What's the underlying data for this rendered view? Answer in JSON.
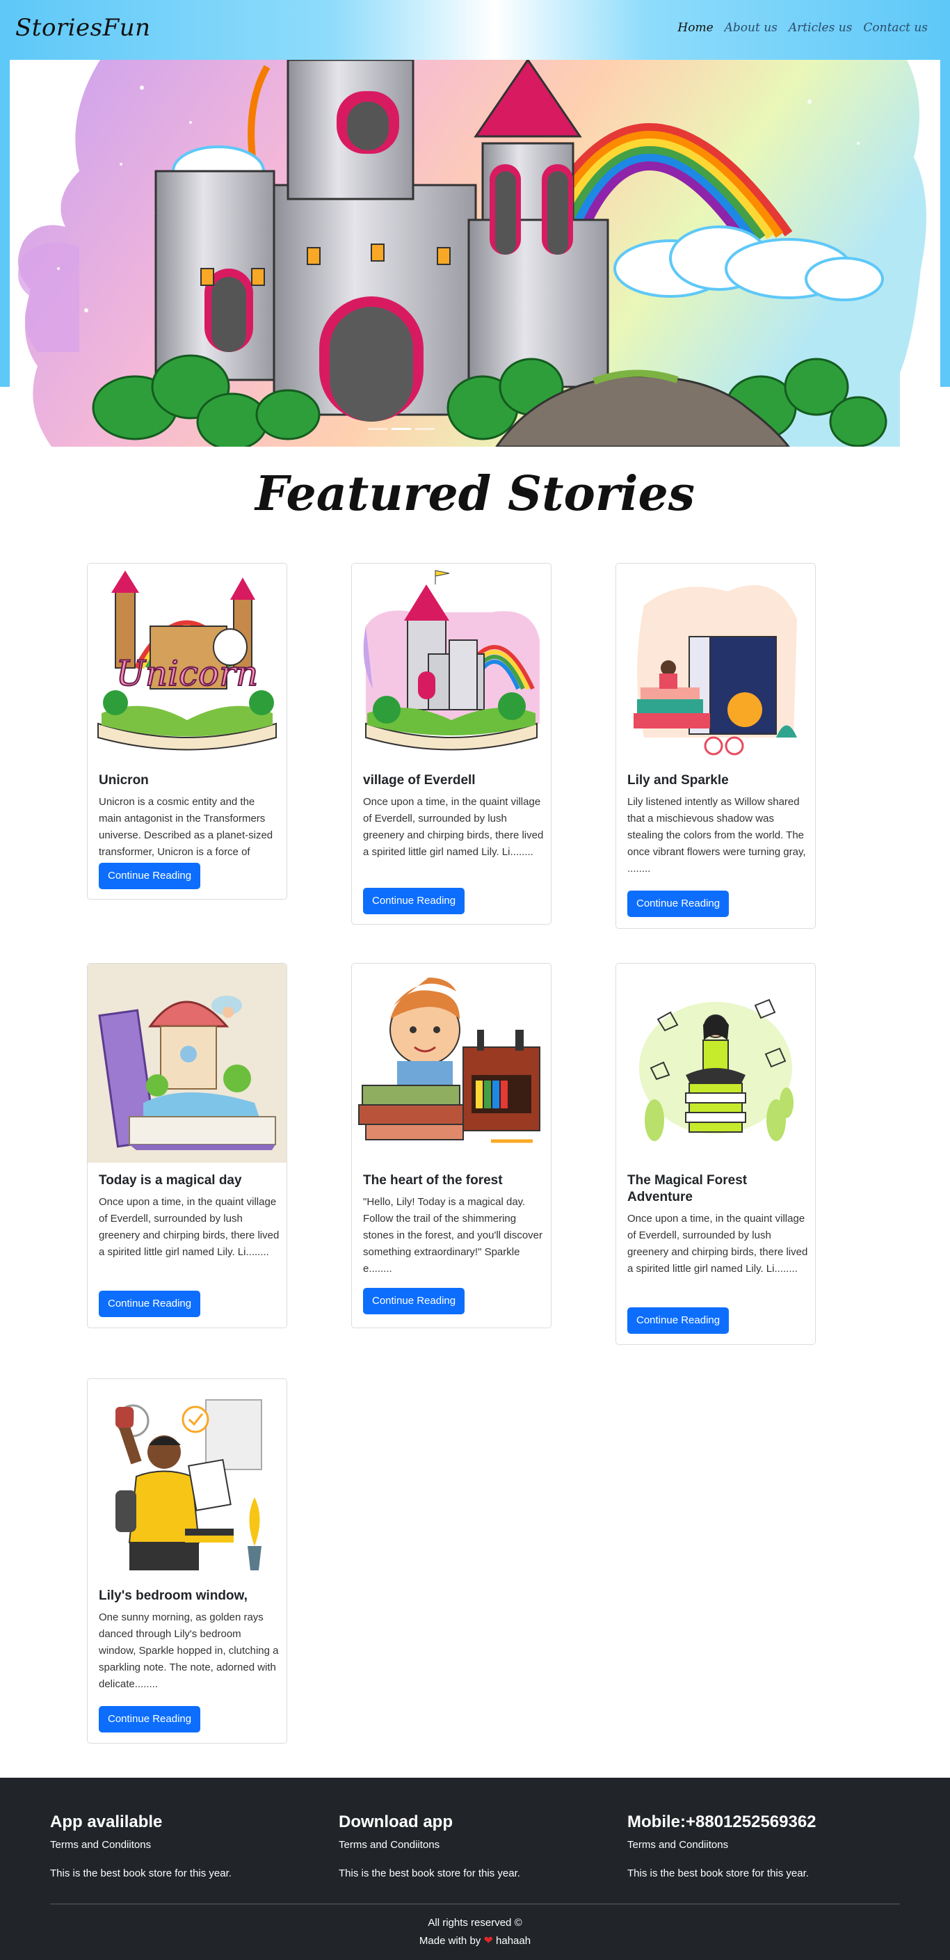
{
  "nav": {
    "brand": "StoriesFun",
    "links": [
      "Home",
      "About us",
      "Articles us",
      "Contact us"
    ]
  },
  "hero": {
    "slide_count": 3,
    "active_slide": 1
  },
  "featured": {
    "title": "Featured Stories",
    "cards": [
      {
        "title": "Unicron",
        "text": "Unicron is a cosmic entity and the main antagonist in the Transformers universe. Described as a planet-sized transformer, Unicron is a force of destru........",
        "button": "Continue Reading",
        "image": "unicorn-castle-book"
      },
      {
        "title": "village of Everdell",
        "text": "Once upon a time, in the quaint village of Everdell, surrounded by lush greenery and chirping birds, there lived a spirited little girl named Lily. Li........",
        "button": "Continue Reading",
        "image": "castle-rainbow-book"
      },
      {
        "title": "Lily and Sparkle",
        "text": "Lily listened intently as Willow shared that a mischievous shadow was stealing the colors from the world. The once vibrant flowers were turning gray, ........",
        "button": "Continue Reading",
        "image": "girl-on-books"
      },
      {
        "title": "Today is a magical day",
        "text": "Once upon a time, in the quaint village of Everdell, surrounded by lush greenery and chirping birds, there lived a spirited little girl named Lily. Li........",
        "button": "Continue Reading",
        "image": "mushroom-house-book"
      },
      {
        "title": "The heart of the forest",
        "text": "\"Hello, Lily! Today is a magical day. Follow the trail of the shimmering stones in the forest, and you'll discover something extraordinary!\" Sparkle e........",
        "button": "Continue Reading",
        "image": "boy-with-books"
      },
      {
        "title": "The Magical Forest Adventure",
        "text": "Once upon a time, in the quaint village of Everdell, surrounded by lush greenery and chirping birds, there lived a spirited little girl named Lily. Li........",
        "button": "Continue Reading",
        "image": "girl-reading-green"
      },
      {
        "title": "Lily's bedroom window,",
        "text": "One sunny morning, as golden rays danced through Lily's bedroom window, Sparkle hopped in, clutching a sparkling note. The note, adorned with delicate........",
        "button": "Continue Reading",
        "image": "student-celebrating"
      }
    ]
  },
  "footer": {
    "columns": [
      {
        "heading": "App avalilable",
        "line1": "Terms and Condiitons",
        "line2": "This is the best book store for this year."
      },
      {
        "heading": "Download app",
        "line1": "Terms and Condiitons",
        "line2": "This is the best book store for this year."
      },
      {
        "heading": "Mobile:+8801252569362",
        "line1": "Terms and Condiitons",
        "line2": "This is the best book store for this year."
      }
    ],
    "copyright": "All rights reserved ©",
    "made_prefix": "Made with by",
    "made_name": "hahaah"
  },
  "colors": {
    "nav_blue": "#5ec8f8",
    "button_blue": "#0d6efd",
    "footer_bg": "#212529",
    "heart_red": "#e0272c"
  }
}
